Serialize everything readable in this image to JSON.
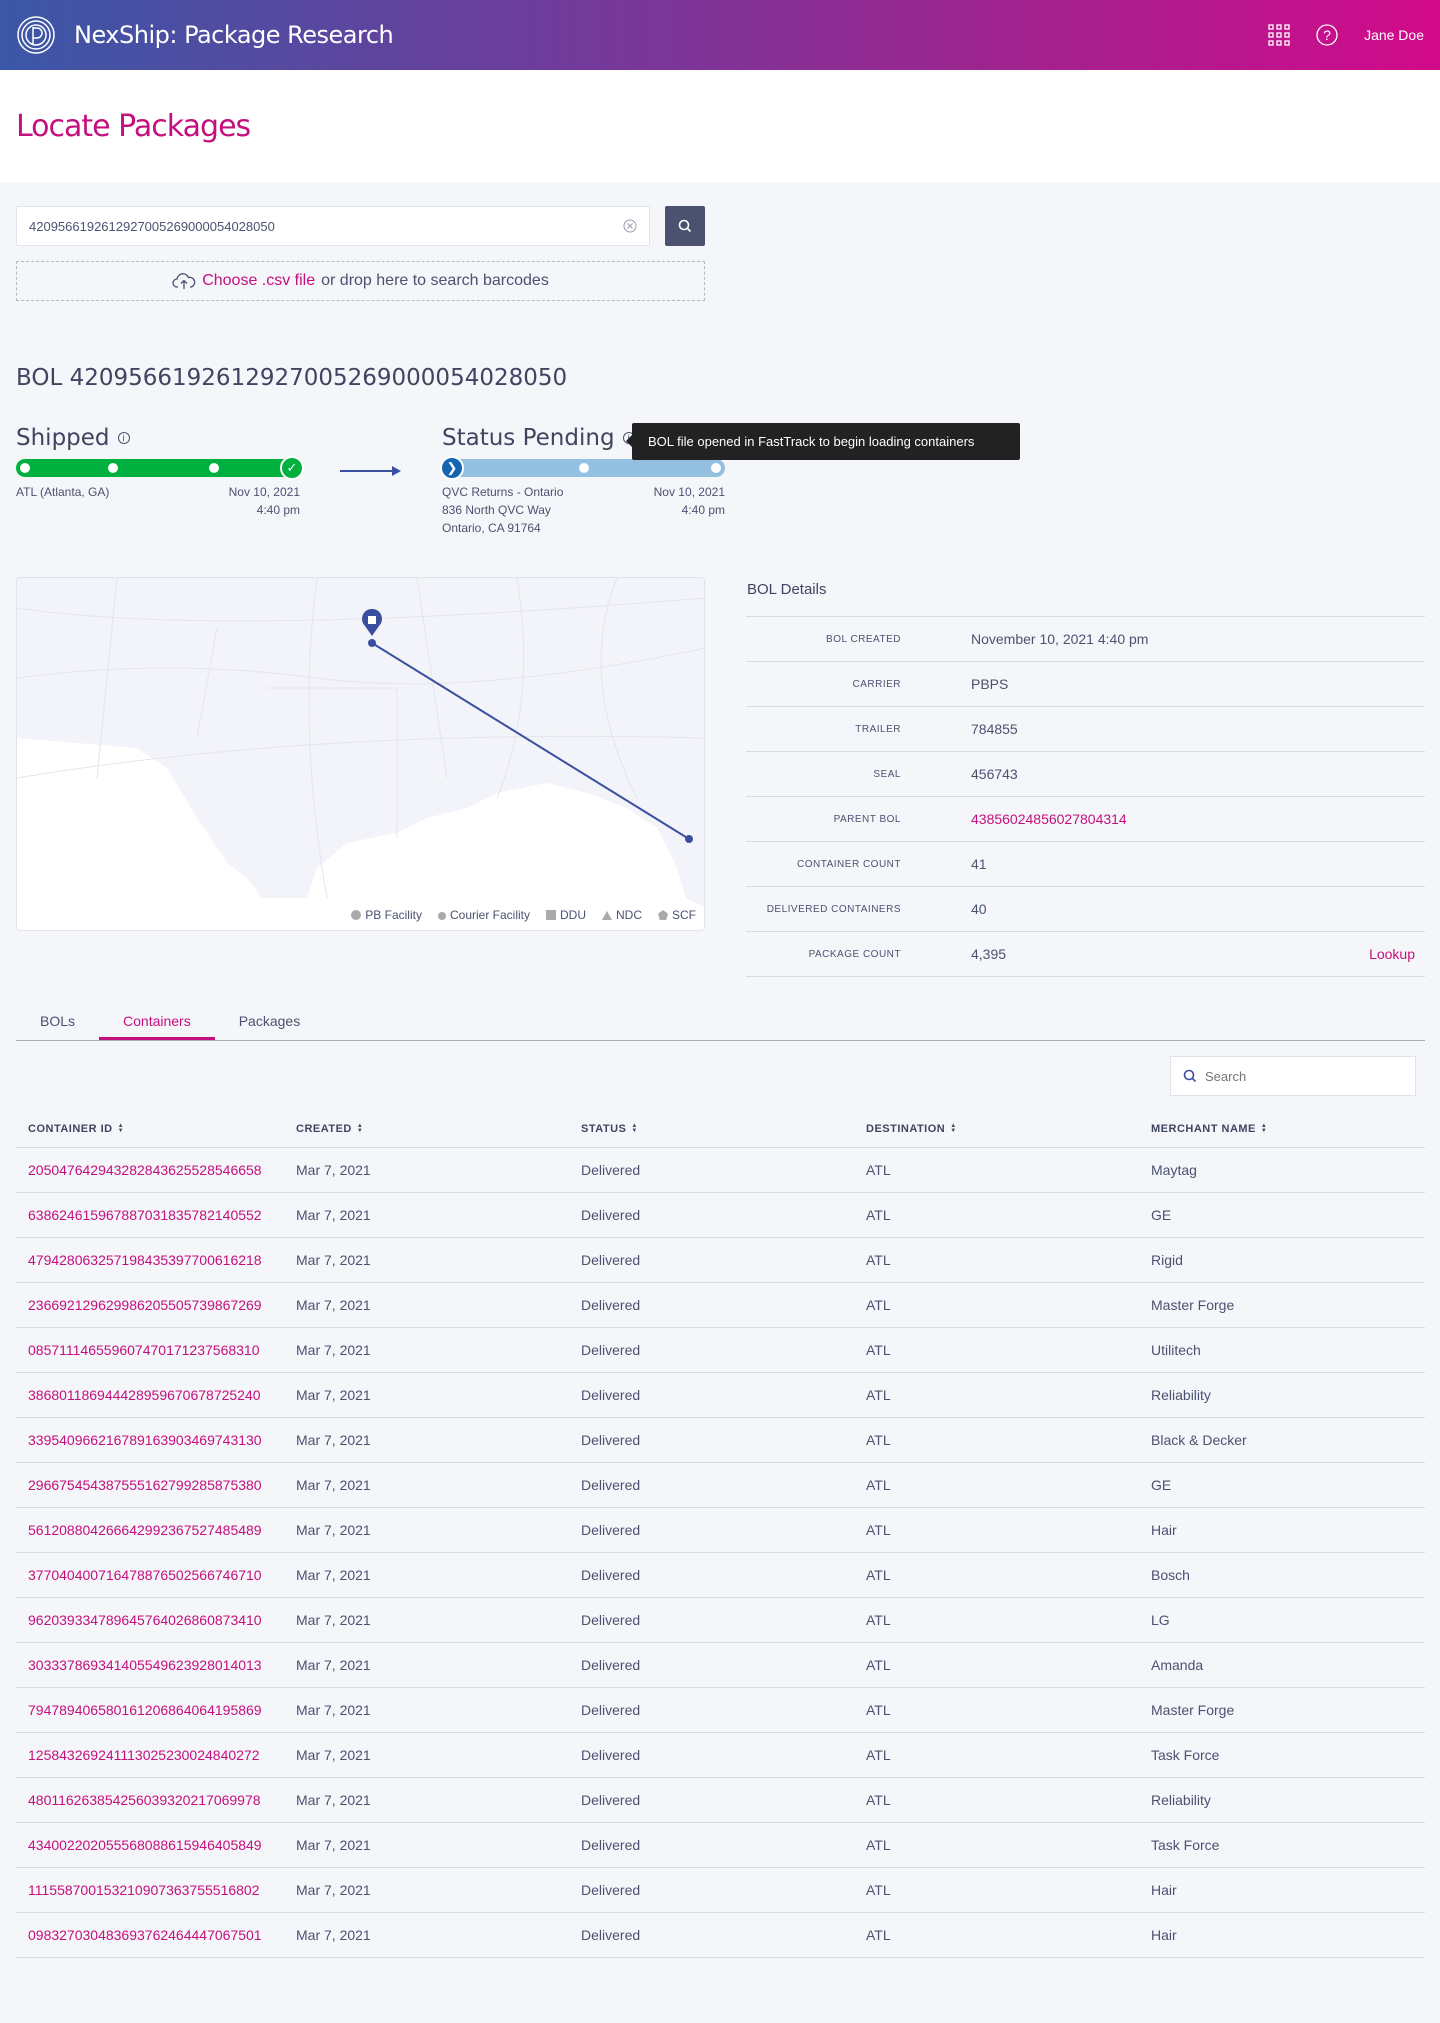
{
  "header": {
    "app_title": "NexShip: Package Research",
    "user": "Jane Doe"
  },
  "page": {
    "title": "Locate Packages"
  },
  "search": {
    "value": "420956619261292700526900005402805​0",
    "choose_label": "Choose .csv file",
    "drop_text": "or drop here to search barcodes"
  },
  "bol": {
    "heading": "BOL 420956619261292700526900005402805​0"
  },
  "steps": {
    "shipped": {
      "title": "Shipped",
      "location": "ATL (Atlanta, GA)",
      "date": "Nov 10, 2021",
      "time": "4:40 pm",
      "color": "#00b140"
    },
    "pending": {
      "title": "Status Pending",
      "location_lines": [
        "QVC Returns - Ontario",
        "836 North QVC Way",
        "Ontario, CA 91764"
      ],
      "date": "Nov 10, 2021",
      "time": "4:40 pm",
      "color": "#93c0e0"
    },
    "tooltip": "BOL file opened in FastTrack to begin loading containers"
  },
  "map": {
    "legend": [
      "PB Facility",
      "Courier Facility",
      "DDU",
      "NDC",
      "SCF"
    ]
  },
  "details": {
    "title": "BOL Details",
    "rows": [
      {
        "label": "BOL CREATED",
        "value": "November 10, 2021  4:40 pm"
      },
      {
        "label": "CARRIER",
        "value": "PBPS"
      },
      {
        "label": "TRAILER",
        "value": "784855"
      },
      {
        "label": "SEAL",
        "value": "456743"
      },
      {
        "label": "PARENT BOL",
        "value": "43856024856027804314"
      },
      {
        "label": "CONTAINER COUNT",
        "value": "41"
      },
      {
        "label": "DELIVERED CONTAINERS",
        "value": "40"
      },
      {
        "label": "PACKAGE COUNT",
        "value": "4,395",
        "action": "Lookup"
      }
    ]
  },
  "tabs": [
    {
      "label": "BOLs"
    },
    {
      "label": "Containers",
      "active": true
    },
    {
      "label": "Packages"
    }
  ],
  "table_search": {
    "placeholder": "Search"
  },
  "table": {
    "columns": [
      "CONTAINER ID",
      "CREATED",
      "STATUS",
      "DESTINATION",
      "MERCHANT NAME"
    ],
    "rows": [
      [
        "20504764294328284362552854665​8",
        "Mar 7, 2021",
        "Delivered",
        "ATL",
        "Maytag"
      ],
      [
        "63862461596788703183578214055​2",
        "Mar 7, 2021",
        "Delivered",
        "ATL",
        "GE"
      ],
      [
        "47942806325719843539770061621​8",
        "Mar 7, 2021",
        "Delivered",
        "ATL",
        "Rigid"
      ],
      [
        "23669212962998620550573986726​9",
        "Mar 7, 2021",
        "Delivered",
        "ATL",
        "Master Forge"
      ],
      [
        "08571114655960747017123756831​0",
        "Mar 7, 2021",
        "Delivered",
        "ATL",
        "Utilitech"
      ],
      [
        "38680118694442895967067872524​0",
        "Mar 7, 2021",
        "Delivered",
        "ATL",
        "Reliability"
      ],
      [
        "33954096621678916390346974313​0",
        "Mar 7, 2021",
        "Delivered",
        "ATL",
        "Black & Decker"
      ],
      [
        "29667545438755516279928587538​0",
        "Mar 7, 2021",
        "Delivered",
        "ATL",
        "GE"
      ],
      [
        "56120880426664299236752748548​9",
        "Mar 7, 2021",
        "Delivered",
        "ATL",
        "Hair"
      ],
      [
        "37704040071647887650256674671​0",
        "Mar 7, 2021",
        "Delivered",
        "ATL",
        "Bosch"
      ],
      [
        "96203933478964576402686087341​0",
        "Mar 7, 2021",
        "Delivered",
        "ATL",
        "LG"
      ],
      [
        "30333786934140554962392801401​3",
        "Mar 7, 2021",
        "Delivered",
        "ATL",
        "Amanda"
      ],
      [
        "79478940658016120686406419586​9",
        "Mar 7, 2021",
        "Delivered",
        "ATL",
        "Master Forge"
      ],
      [
        "12584326924111302523002484027​2",
        "Mar 7, 2021",
        "Delivered",
        "ATL",
        "Task Force"
      ],
      [
        "48011626385425603932021706997​8",
        "Mar 7, 2021",
        "Delivered",
        "ATL",
        "Reliability"
      ],
      [
        "43400220205556808861594640584​9",
        "Mar 7, 2021",
        "Delivered",
        "ATL",
        "Task Force"
      ],
      [
        "11155870015321090736375551680​2",
        "Mar 7, 2021",
        "Delivered",
        "ATL",
        "Hair"
      ],
      [
        "09832703048369376246444706750​1",
        "Mar 7, 2021",
        "Delivered",
        "ATL",
        "Hair"
      ]
    ]
  },
  "colors": {
    "accent": "#c4107e",
    "primary": "#3b4fa0",
    "text": "#4b5270"
  }
}
